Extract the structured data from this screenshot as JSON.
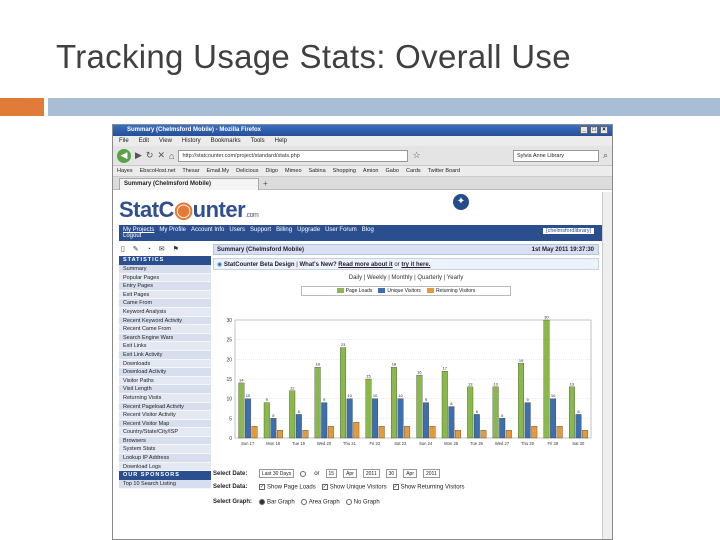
{
  "slide": {
    "title": "Tracking Usage Stats: Overall Use"
  },
  "browser": {
    "window_title": "Summary (Chelmsford Mobile) - Mozilla Firefox",
    "menu": [
      "File",
      "Edit",
      "View",
      "History",
      "Bookmarks",
      "Tools",
      "Help"
    ],
    "url": "http://statcounter.com/project/standard/stats.php",
    "search_placeholder": "Sylvia Anne Library",
    "bookmarks": [
      "Hayes",
      "EbscoHost.net",
      "Thesar",
      "Email.My",
      "Delicious",
      "Diigo",
      "Mimeo",
      "Sabina",
      "Shopping",
      "Amion",
      "Gabo",
      "Cards",
      "Twitter Board"
    ],
    "tab_label": "Summary (Chelmsford Mobile)",
    "tab_plus": "+"
  },
  "site": {
    "logo_a": "StatC",
    "logo_b": "unter",
    "logo_com": ".com",
    "nav": [
      "My Projects",
      "My Profile",
      "Account Info",
      "Users",
      "Support",
      "Billing",
      "Upgrade",
      "User Forum",
      "Blog"
    ],
    "logout": "Logout",
    "account": "[chelmsfordlibrary]",
    "icons_row": "▯ ✎ ◔ ✉ ⚑",
    "stats_heading": "STATISTICS",
    "menu_items": [
      "Summary",
      "Popular Pages",
      "Entry Pages",
      "Exit Pages",
      "Came From",
      "Keyword Analysis",
      "Recent Keyword Activity",
      "Recent Came From",
      "Search Engine Wars",
      "Exit Links",
      "Exit Link Activity",
      "Downloads",
      "Download Activity",
      "Visitor Paths",
      "Visit Length",
      "Returning Visits",
      "Recent Pageload Activity",
      "Recent Visitor Activity",
      "Recent Visitor Map",
      "Country/State/City/ISP",
      "Browsers",
      "System Stats",
      "Lookup IP Address",
      "Download Logs"
    ],
    "sponsors_heading": "OUR SPONSORS",
    "sponsor_items": [
      "Top 10 Search Listing"
    ],
    "summary_title": "Summary (Chelmsford Mobile)",
    "summary_date": "1st May 2011 19:37:30",
    "beta_prefix": "StatCounter Beta Design",
    "beta_q": "What's New?",
    "beta_read": "Read more about it",
    "beta_or": "or",
    "beta_try": "try it here.",
    "periods": "Daily | Weekly | Monthly | Quarterly | Yearly",
    "legend": [
      "Page Loads",
      "Unique Visitors",
      "Returning Visitors"
    ],
    "select_date_label": "Select Date:",
    "date_range": "Last 30 Days",
    "or_label": "or",
    "date_from": [
      "15",
      "Apr",
      "2011"
    ],
    "date_to": [
      "30",
      "Apr",
      "2011"
    ],
    "select_data_label": "Select Data:",
    "data_options": [
      "Show Page Loads",
      "Show Unique Visitors",
      "Show Returning Visitors"
    ],
    "select_graph_label": "Select Graph:",
    "graph_options": [
      "Bar Graph",
      "Area Graph",
      "No Graph"
    ]
  },
  "colors": {
    "page_loads": "#8ab84a",
    "unique": "#3d6fb0",
    "returning": "#e39a3a",
    "accent": "#e07b38",
    "band": "#a9bdd4"
  },
  "chart_data": {
    "type": "bar",
    "categories": [
      "Sun 17",
      "Mon 18",
      "Tue 19",
      "Wed 20",
      "Thu 21",
      "Fri 22",
      "Sat 23",
      "Sun 24",
      "Mon 25",
      "Tue 26",
      "Wed 27",
      "Thu 28",
      "Fri 29",
      "Sat 30"
    ],
    "series": [
      {
        "name": "Page Loads",
        "values": [
          14,
          9,
          12,
          18,
          23,
          15,
          18,
          16,
          17,
          13,
          13,
          19,
          30,
          13
        ]
      },
      {
        "name": "Unique Visitors",
        "values": [
          10,
          5,
          6,
          9,
          10,
          10,
          10,
          9,
          8,
          6,
          5,
          9,
          10,
          6
        ]
      },
      {
        "name": "Returning Visitors",
        "values": [
          3,
          2,
          2,
          3,
          4,
          3,
          3,
          3,
          2,
          2,
          2,
          3,
          3,
          2
        ]
      }
    ],
    "ylim": [
      0,
      30
    ],
    "yticks": [
      "30",
      "25",
      "20",
      "15",
      "10",
      "5",
      "0"
    ]
  }
}
